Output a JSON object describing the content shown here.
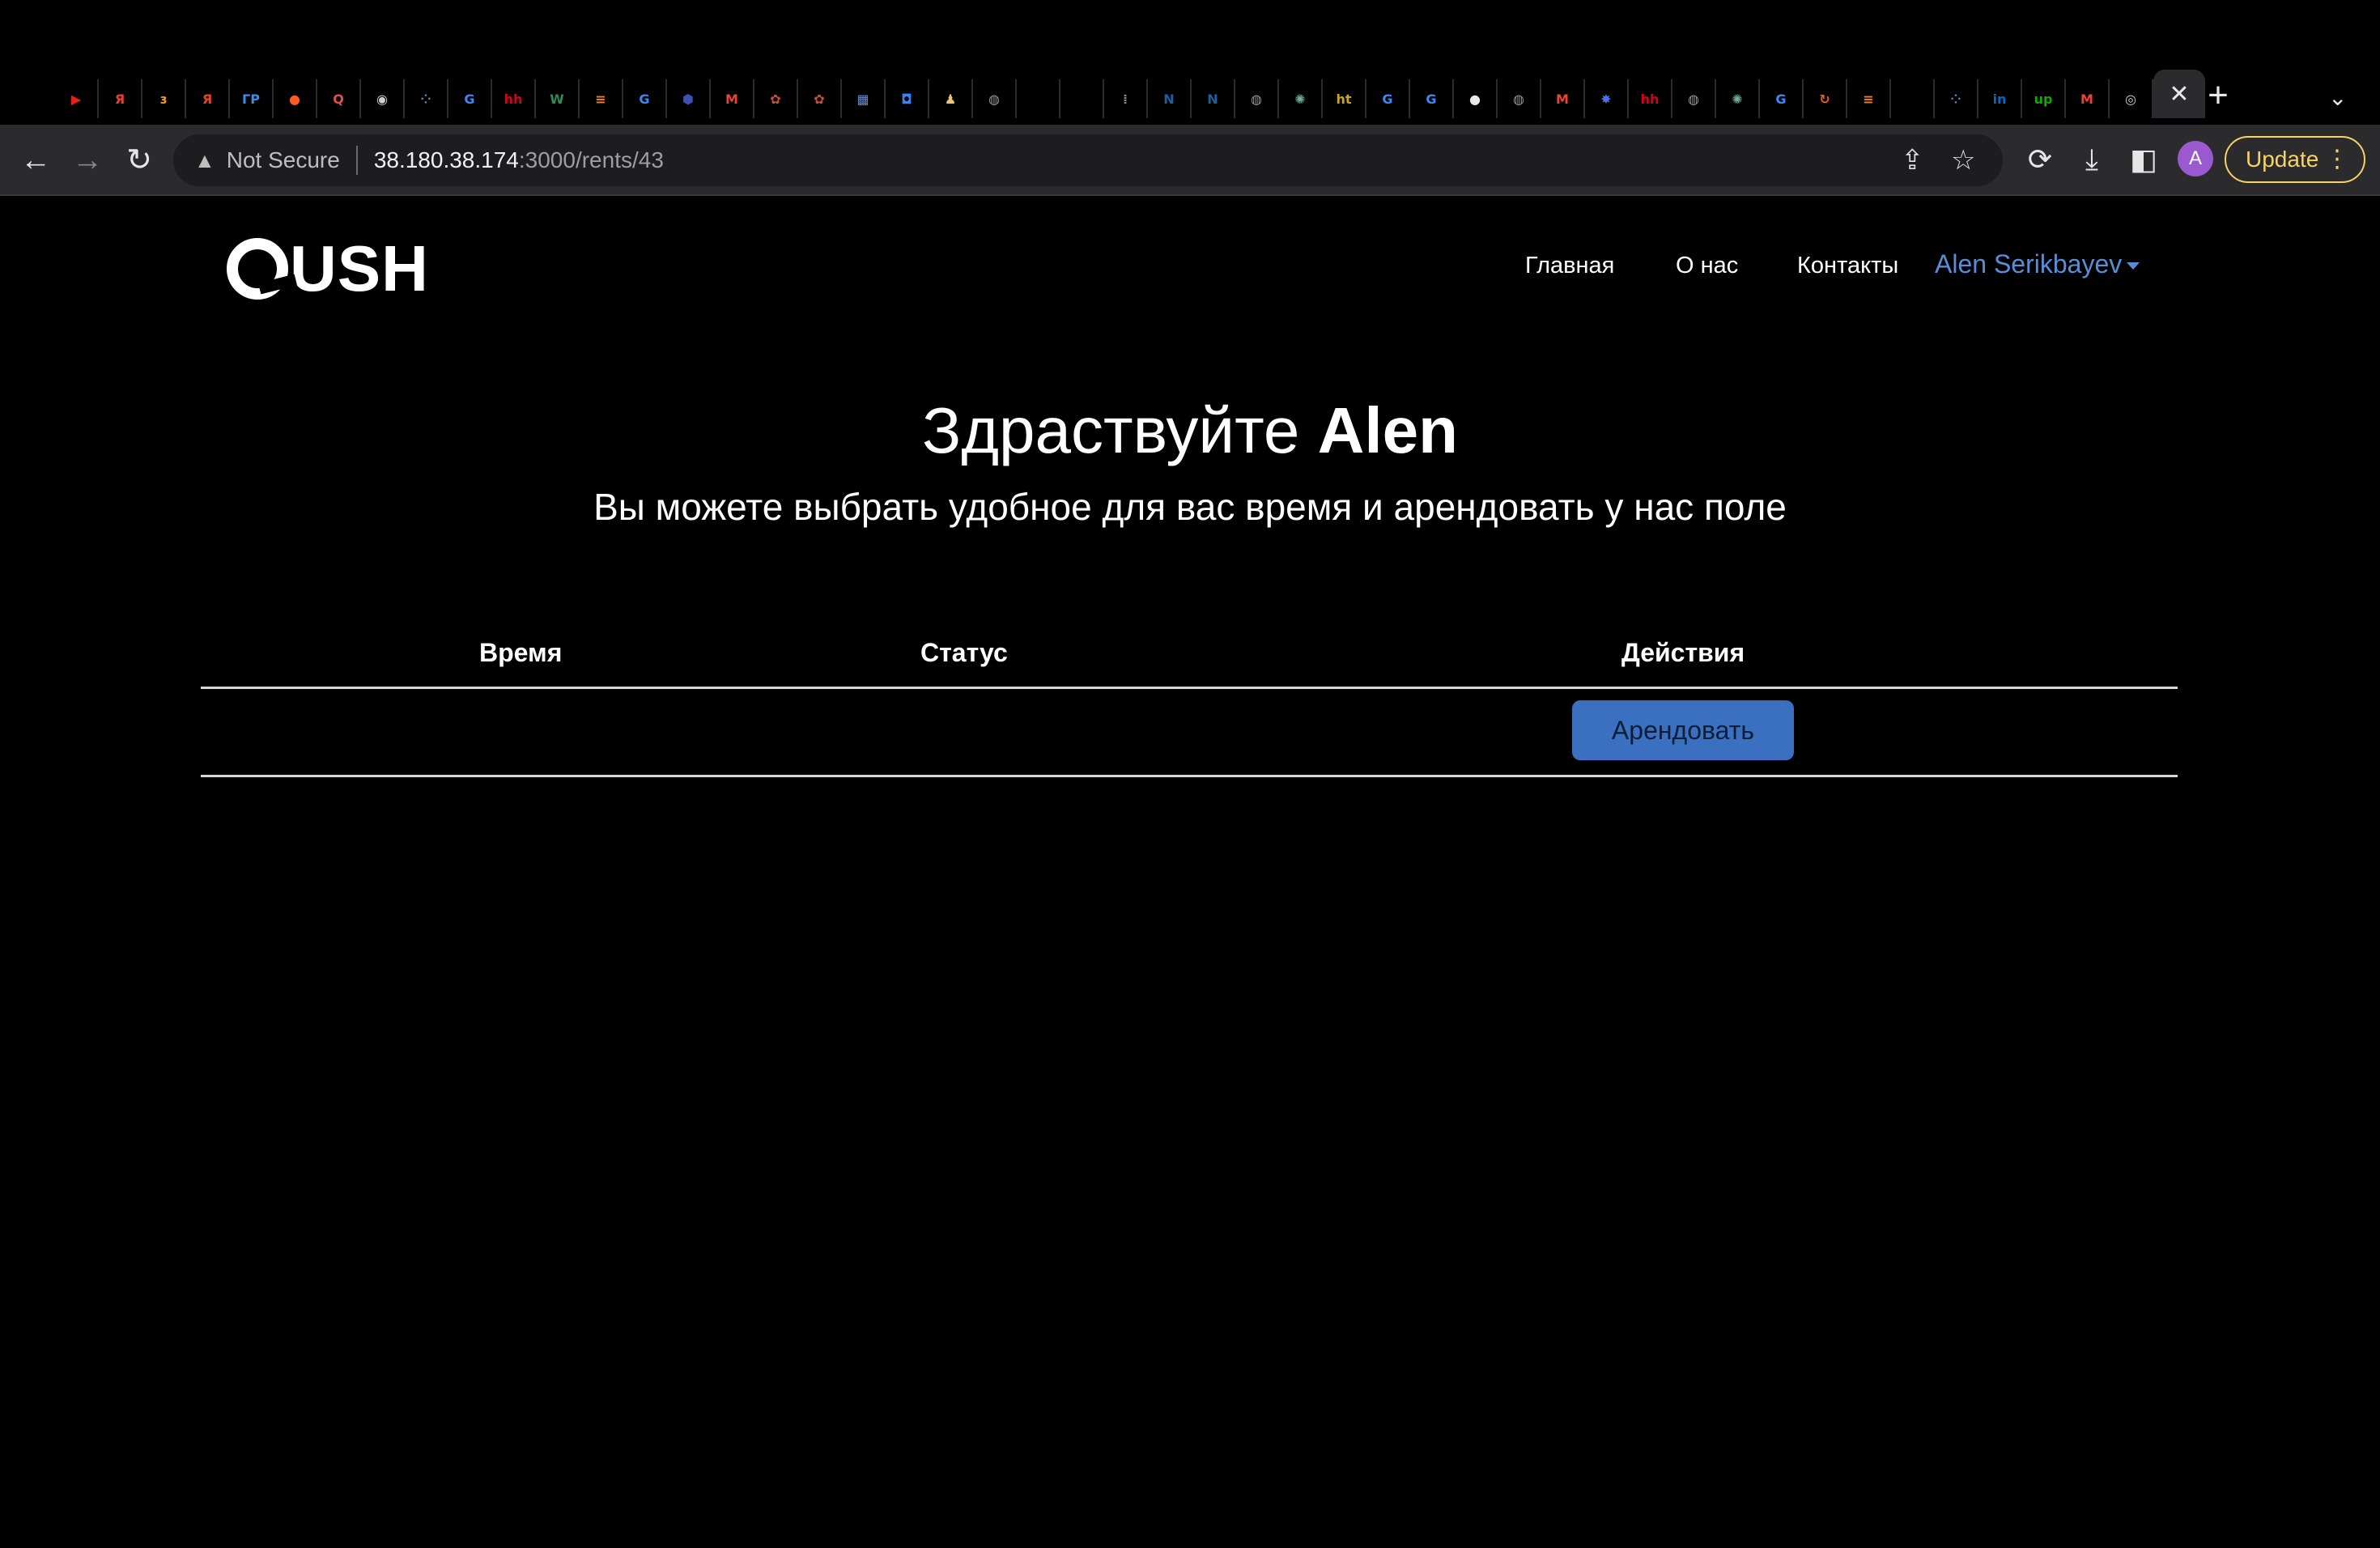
{
  "browser": {
    "tabs": [
      {
        "icon": "youtube-icon",
        "glyph": "▶",
        "color": "#e62117"
      },
      {
        "icon": "yandex-icon",
        "glyph": "Я",
        "color": "#e8412c"
      },
      {
        "icon": "torrent-icon",
        "glyph": "ɜ",
        "color": "#f09a2a"
      },
      {
        "icon": "yandex-icon",
        "glyph": "Я",
        "color": "#e8412c"
      },
      {
        "icon": "gr-icon",
        "glyph": "ГР",
        "color": "#3a8ee6"
      },
      {
        "icon": "reddit-icon",
        "glyph": "●",
        "color": "#ff5a1f"
      },
      {
        "icon": "search-app-icon",
        "glyph": "Q",
        "color": "#e05050"
      },
      {
        "icon": "chrome-icon",
        "glyph": "◉",
        "color": "#cfcfcf"
      },
      {
        "icon": "loading-icon",
        "glyph": "⁘",
        "color": "#5a7fa8"
      },
      {
        "icon": "google-icon",
        "glyph": "G",
        "color": "#4285f4"
      },
      {
        "icon": "hh-icon",
        "glyph": "hh",
        "color": "#d6001c"
      },
      {
        "icon": "w-icon",
        "glyph": "W",
        "color": "#2e8b57"
      },
      {
        "icon": "stackoverflow-icon",
        "glyph": "≡",
        "color": "#f48024"
      },
      {
        "icon": "google-icon",
        "glyph": "G",
        "color": "#4285f4"
      },
      {
        "icon": "shield-app-icon",
        "glyph": "⬢",
        "color": "#3f51b5"
      },
      {
        "icon": "gmail-icon",
        "glyph": "M",
        "color": "#ea4335"
      },
      {
        "icon": "app-icon",
        "glyph": "✿",
        "color": "#c84e3a"
      },
      {
        "icon": "app-icon",
        "glyph": "✿",
        "color": "#c84e3a"
      },
      {
        "icon": "picture-icon",
        "glyph": "▦",
        "color": "#6b8cc7"
      },
      {
        "icon": "chat-icon",
        "glyph": "◘",
        "color": "#3b82f6"
      },
      {
        "icon": "person-icon",
        "glyph": "♟",
        "color": "#f0c37a"
      },
      {
        "icon": "globe-icon",
        "glyph": "◍",
        "color": "#9a9a9a"
      },
      {
        "icon": "blank-icon",
        "glyph": "",
        "color": "#000000"
      },
      {
        "icon": "blank-icon",
        "glyph": "",
        "color": "#000000"
      },
      {
        "icon": "cisco-icon",
        "glyph": "⁞",
        "color": "#888888"
      },
      {
        "icon": "notion-icon",
        "glyph": "N",
        "color": "#1f5fa0"
      },
      {
        "icon": "notion-icon",
        "glyph": "N",
        "color": "#1f5fa0"
      },
      {
        "icon": "globe-icon",
        "glyph": "◍",
        "color": "#9a9a9a"
      },
      {
        "icon": "openai-icon",
        "glyph": "✺",
        "color": "#74aa9c"
      },
      {
        "icon": "ht-icon",
        "glyph": "ht",
        "color": "#c9a227"
      },
      {
        "icon": "google-icon",
        "glyph": "G",
        "color": "#4285f4"
      },
      {
        "icon": "google-icon",
        "glyph": "G",
        "color": "#4285f4"
      },
      {
        "icon": "github-icon",
        "glyph": "●",
        "color": "#e8e8e8"
      },
      {
        "icon": "globe-icon",
        "glyph": "◍",
        "color": "#9a9a9a"
      },
      {
        "icon": "gmail-icon",
        "glyph": "M",
        "color": "#ea4335"
      },
      {
        "icon": "star-app-icon",
        "glyph": "✸",
        "color": "#4f6fe8"
      },
      {
        "icon": "hh-icon",
        "glyph": "hh",
        "color": "#d6001c"
      },
      {
        "icon": "globe-icon",
        "glyph": "◍",
        "color": "#9a9a9a"
      },
      {
        "icon": "openai-icon",
        "glyph": "✺",
        "color": "#74aa9c"
      },
      {
        "icon": "google-icon",
        "glyph": "G",
        "color": "#4285f4"
      },
      {
        "icon": "refresh-app-icon",
        "glyph": "↻",
        "color": "#f05a28"
      },
      {
        "icon": "stackoverflow-icon",
        "glyph": "≡",
        "color": "#f48024"
      },
      {
        "icon": "blank-icon",
        "glyph": "",
        "color": "#000000"
      },
      {
        "icon": "loading-icon",
        "glyph": "⁘",
        "color": "#5a7fa8"
      },
      {
        "icon": "linkedin-icon",
        "glyph": "in",
        "color": "#0a66c2"
      },
      {
        "icon": "upwork-icon",
        "glyph": "up",
        "color": "#14a800"
      },
      {
        "icon": "gmail-icon",
        "glyph": "M",
        "color": "#ea4335"
      },
      {
        "icon": "sync-icon",
        "glyph": "◎",
        "color": "#d0d0d0"
      }
    ],
    "active_tab_close": "✕",
    "new_tab": "+",
    "tab_menu": "⌄",
    "security_label": "Not Secure",
    "url_host": "38.180.38.174",
    "url_path": ":3000/rents/43",
    "profile_initial": "A",
    "update_label": "Update"
  },
  "site": {
    "logo_text": "USH",
    "nav": {
      "home": "Главная",
      "about": "О нас",
      "contacts": "Контакты",
      "user": "Alen Serikbayev"
    },
    "greeting": "Здраствуйте",
    "user_first_name": "Alen",
    "subtitle": "Вы можете выбрать удобное для вас время и арендовать у нас поле",
    "table": {
      "headers": [
        "Время",
        "Статус",
        "Действия"
      ],
      "rows": [
        {
          "time": "",
          "status": "",
          "action_label": "Арендовать"
        }
      ]
    }
  }
}
